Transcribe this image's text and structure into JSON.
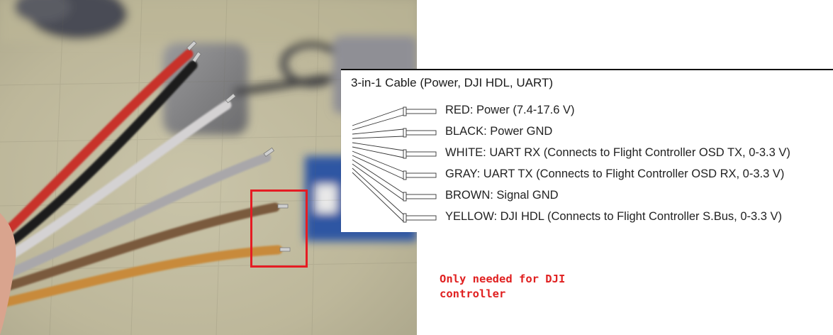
{
  "diagram": {
    "title": "3-in-1 Cable (Power, DJI HDL, UART)",
    "wires": [
      {
        "label": "RED: Power (7.4-17.6 V)"
      },
      {
        "label": "BLACK: Power GND"
      },
      {
        "label": "WHITE: UART RX (Connects to Flight Controller OSD TX, 0-3.3 V)"
      },
      {
        "label": "GRAY: UART TX (Connects to Flight Controller OSD RX, 0-3.3 V)"
      },
      {
        "label": "BROWN: Signal GND"
      },
      {
        "label": "YELLOW: DJI HDL (Connects to Flight Controller S.Bus, 0-3.3 V)"
      }
    ]
  },
  "annotation": {
    "note": "Only needed for DJI controller",
    "color": "#e02020",
    "highlight_color": "#e51c23"
  },
  "photo": {
    "wire_colors": [
      "#c8322c",
      "#1b1b1b",
      "#d4d2d3",
      "#a9a7aa",
      "#7a5a3e",
      "#c88a3a"
    ]
  }
}
